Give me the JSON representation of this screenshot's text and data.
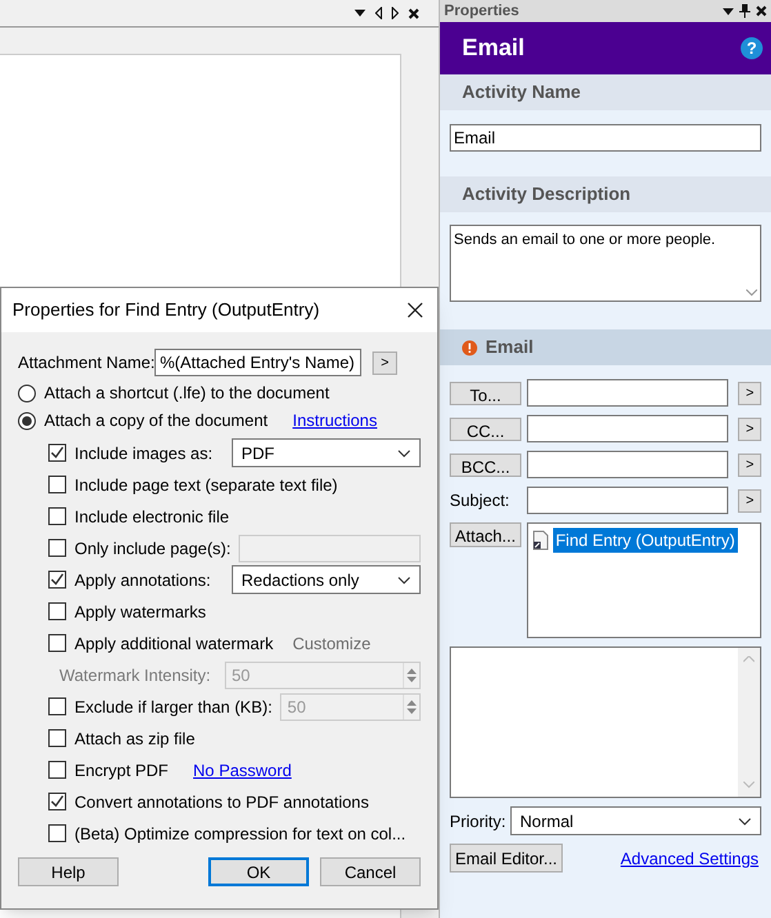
{
  "properties_panel": {
    "title": "Properties",
    "header": {
      "title": "Email",
      "help": "?"
    },
    "activity_name": {
      "heading": "Activity Name",
      "value": "Email"
    },
    "activity_description": {
      "heading": "Activity Description",
      "value": "Sends an email to one or more people."
    },
    "email": {
      "heading": "Email",
      "recipients": [
        {
          "kind": "button",
          "label": "To...",
          "arrow": ">"
        },
        {
          "kind": "button",
          "label": "CC...",
          "arrow": ">"
        },
        {
          "kind": "button",
          "label": "BCC...",
          "arrow": ">"
        },
        {
          "kind": "label",
          "label": "Subject:",
          "arrow": ">"
        }
      ],
      "attach": {
        "label": "Attach...",
        "items": [
          {
            "name": "Find Entry (OutputEntry)",
            "selected": true
          }
        ]
      },
      "priority": {
        "label": "Priority:",
        "value": "Normal"
      },
      "editor_button": "Email Editor...",
      "advanced_link": "Advanced Settings"
    }
  },
  "dialog": {
    "title": "Properties for Find Entry (OutputEntry)",
    "attachment_name": {
      "label": "Attachment Name:",
      "value": "%(Attached Entry's Name)",
      "button": ">"
    },
    "modes": [
      {
        "label": "Attach a shortcut (.lfe) to the document",
        "selected": false
      },
      {
        "label": "Attach a copy of the document",
        "selected": true,
        "link": "Instructions"
      }
    ],
    "options": [
      {
        "kind": "dropdown",
        "label": "Include images as:",
        "checked": true,
        "value": "PDF"
      },
      {
        "kind": "check",
        "label": "Include page text (separate text file)",
        "checked": false
      },
      {
        "kind": "check",
        "label": "Include electronic file",
        "checked": false
      },
      {
        "kind": "field",
        "label": "Only include page(s):",
        "checked": false
      },
      {
        "kind": "dropdown",
        "label": "Apply annotations:",
        "checked": true,
        "value": "Redactions only"
      },
      {
        "kind": "check",
        "label": "Apply watermarks",
        "checked": false
      },
      {
        "kind": "check",
        "label": "Apply additional watermark",
        "checked": false,
        "note": "Customize"
      },
      {
        "kind": "spinner",
        "label": "Watermark Intensity:",
        "value": "50"
      },
      {
        "kind": "spinner",
        "label": "Exclude if larger than (KB):",
        "checked": false,
        "value": "50"
      },
      {
        "kind": "check",
        "label": "Attach as zip file",
        "checked": false
      },
      {
        "kind": "check",
        "label": "Encrypt PDF",
        "checked": false,
        "link": "No Password"
      },
      {
        "kind": "check",
        "label": "Convert annotations to PDF annotations",
        "checked": true
      },
      {
        "kind": "check",
        "label": "(Beta) Optimize compression for text on col...",
        "checked": false
      }
    ],
    "buttons": [
      {
        "label": "Help",
        "default": false
      },
      {
        "label": "OK",
        "default": true
      },
      {
        "label": "Cancel",
        "default": false
      }
    ]
  }
}
